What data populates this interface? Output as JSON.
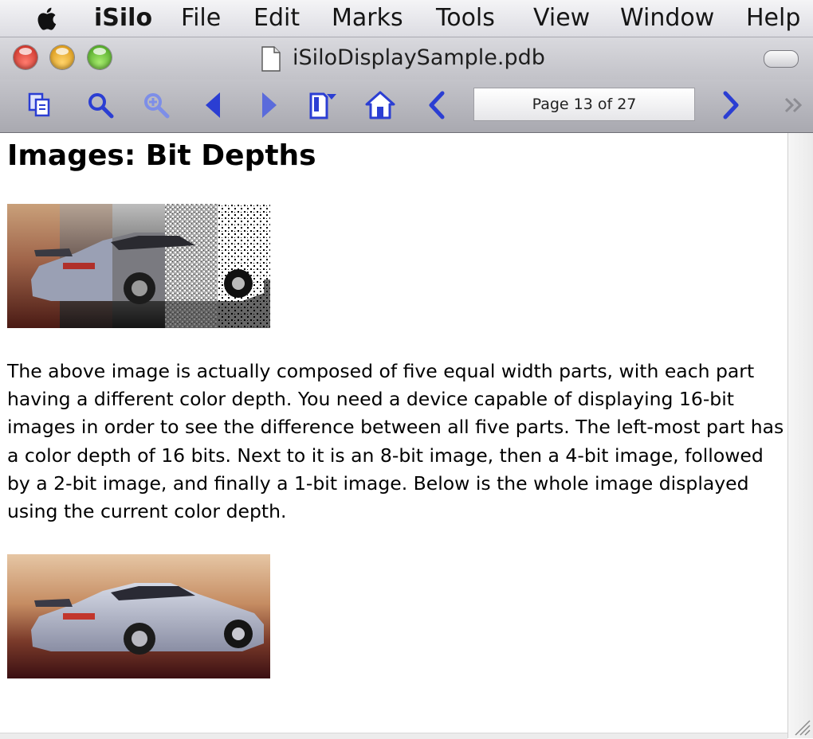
{
  "menubar": {
    "app_name": "iSilo",
    "items": [
      "File",
      "Edit",
      "Marks",
      "Tools",
      "View",
      "Window",
      "Help"
    ]
  },
  "window": {
    "title": "iSiloDisplaySample.pdb",
    "buttons": [
      "close",
      "minimize",
      "zoom"
    ]
  },
  "toolbar": {
    "icons": [
      "copy-icon",
      "search-icon",
      "zoom-in-icon",
      "back-icon",
      "forward-icon",
      "bookmark-icon",
      "home-icon",
      "previous-page-icon",
      "next-page-icon",
      "overflow-chevron-icon"
    ],
    "page_indicator": "Page 13 of 27"
  },
  "document": {
    "heading": "Images: Bit Depths",
    "paragraph": "The above image is actually composed of five equal width parts, with each part having a different color depth. You need a device capable of displaying 16-bit images in order to see the difference between all five parts. The left-most part has a color depth of 16 bits. Next to it is an 8-bit image, then a 4-bit image, followed by a 2-bit image, and finally a 1-bit image. Below is the whole image displayed using the current color depth.",
    "images": [
      "bit-depth-comparison-car-image",
      "full-color-car-image"
    ]
  },
  "colors": {
    "toolbar_icon": "#2b3ed3",
    "toolbar_icon_light": "#7d8ee8"
  }
}
